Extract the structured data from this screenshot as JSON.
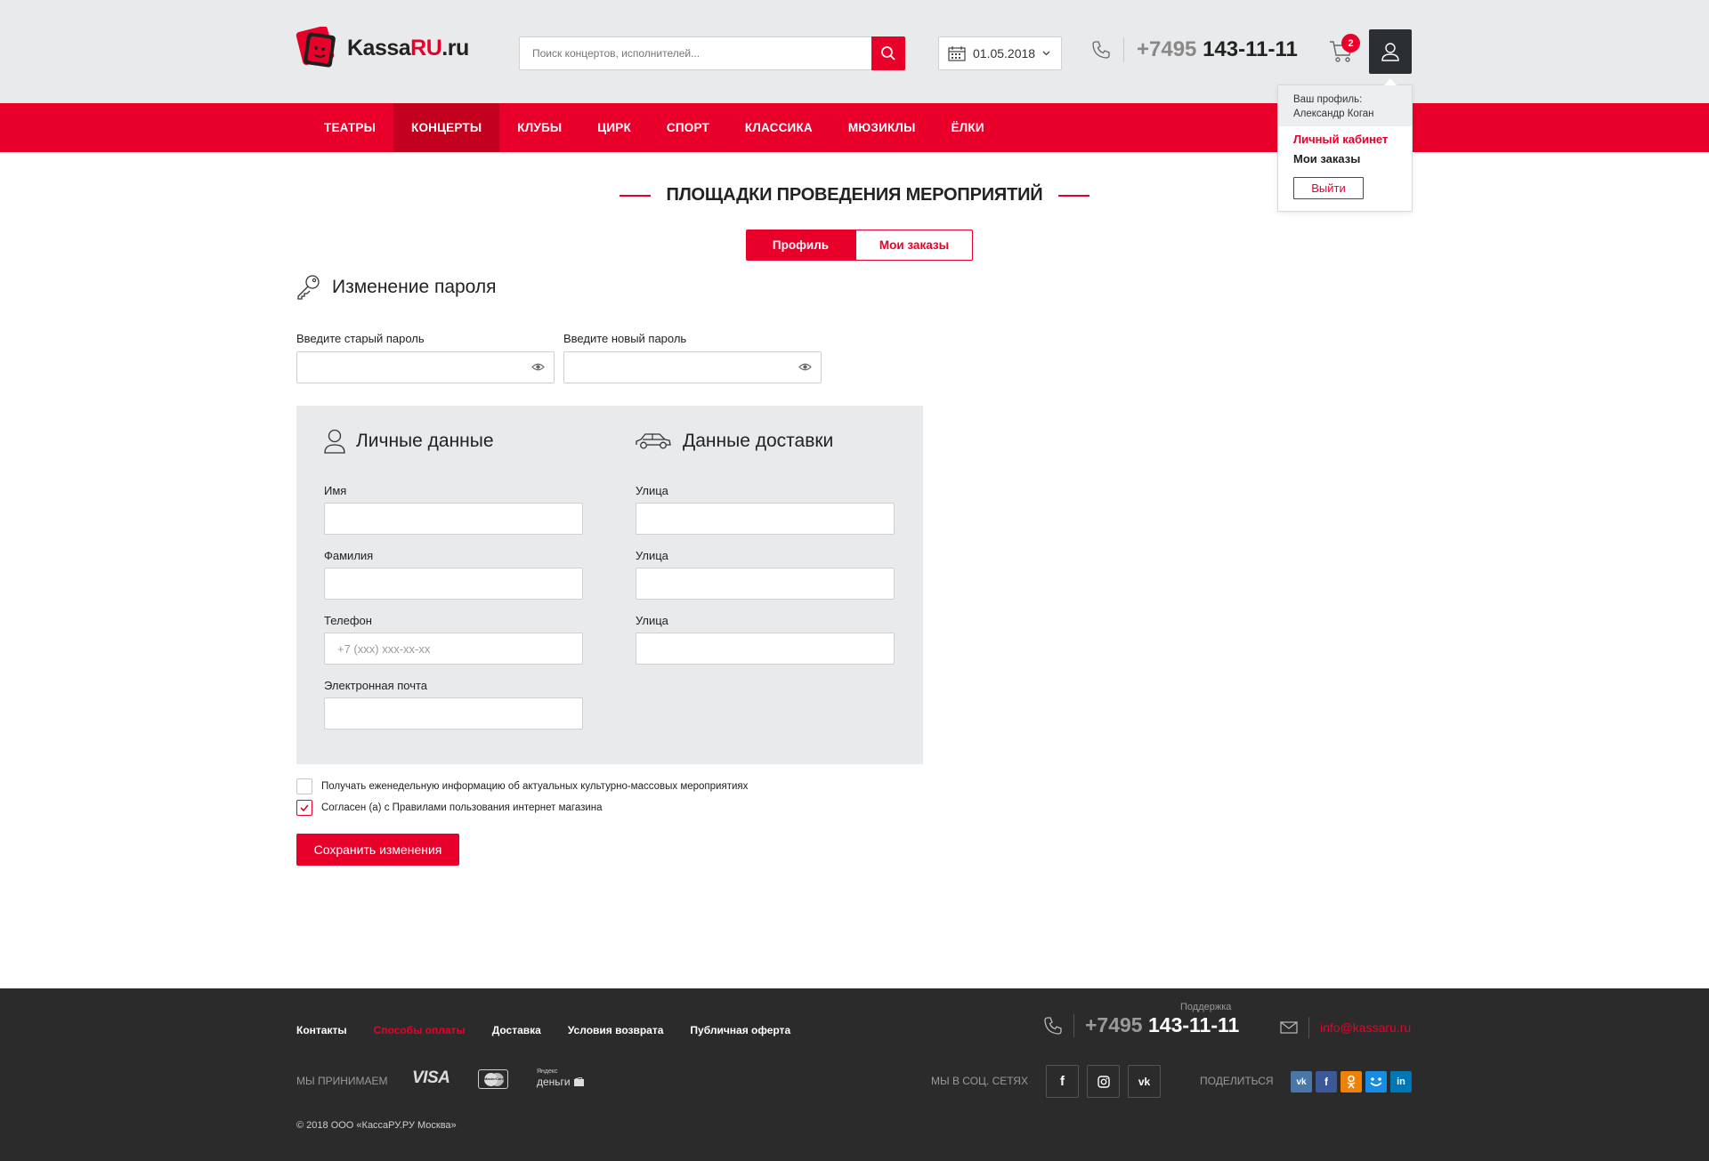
{
  "header": {
    "logo": {
      "text_main": "Kassa",
      "text_accent": "RU",
      "text_tail": ".ru"
    },
    "search": {
      "placeholder": "Поиск концертов, исполнителей..."
    },
    "date": "01.05.2018",
    "phone": {
      "code": "+7495",
      "number": "143-11-11"
    },
    "cart_count": "2"
  },
  "profile_menu": {
    "label": "Ваш профиль:",
    "user_name": "Александр Коган",
    "cabinet": "Личный кабинет",
    "orders": "Мои заказы",
    "logout": "Выйти"
  },
  "nav": {
    "items": [
      {
        "label": "ТЕАТРЫ",
        "active": false
      },
      {
        "label": "КОНЦЕРТЫ",
        "active": true
      },
      {
        "label": "КЛУБЫ",
        "active": false
      },
      {
        "label": "ЦИРК",
        "active": false
      },
      {
        "label": "СПОРТ",
        "active": false
      },
      {
        "label": "КЛАССИКА",
        "active": false
      },
      {
        "label": "МЮЗИКЛЫ",
        "active": false
      },
      {
        "label": "ЁЛКИ",
        "active": false
      }
    ]
  },
  "page": {
    "title": "ПЛОЩАДКИ ПРОВЕДЕНИЯ МЕРОПРИЯТИЙ",
    "tabs": {
      "profile": "Профиль",
      "orders": "Мои заказы"
    }
  },
  "password": {
    "heading": "Изменение пароля",
    "old_label": "Введите старый пароль",
    "new_label": "Введите новый пароль"
  },
  "personal": {
    "heading": "Личные данные",
    "first_name_label": "Имя",
    "last_name_label": "Фамилия",
    "phone_label": "Телефон",
    "phone_placeholder": "+7 (xxx) xxx-xx-xx",
    "email_label": "Электронная почта"
  },
  "delivery": {
    "heading": "Данные доставки",
    "street1_label": "Улица",
    "street2_label": "Улица",
    "street3_label": "Улица"
  },
  "checkboxes": {
    "newsletter": {
      "label": "Получать еженедельную информацию об актуальных культурно-массовых мероприятиях",
      "checked": false
    },
    "terms": {
      "label": "Согласен (а) с Правилами пользования интернет магазина",
      "checked": true
    }
  },
  "save_button": "Сохранить изменения",
  "footer": {
    "links": [
      "Контакты",
      "Способы оплаты",
      "Доставка",
      "Условия возврата",
      "Публичная оферта"
    ],
    "support_label": "Поддержка",
    "phone": {
      "code": "+7495",
      "number": "143-11-11"
    },
    "email": "info@kassaru.ru",
    "accept_label": "МЫ ПРИНИМАЕМ",
    "payment": {
      "visa": "VISA",
      "mastercard": "MasterCard",
      "yandex_top": "Яндекс",
      "yandex_bottom": "деньги"
    },
    "social_label": "МЫ В СОЦ. СЕТЯХ",
    "share_label": "ПОДЕЛИТЬСЯ",
    "copyright": "© 2018 ООО «КассаРУ.РУ Москва»"
  },
  "colors": {
    "accent": "#e8002a",
    "nav_active": "#c4001f",
    "header_bg": "#e9eaec",
    "footer_bg": "#2b2b2b"
  }
}
